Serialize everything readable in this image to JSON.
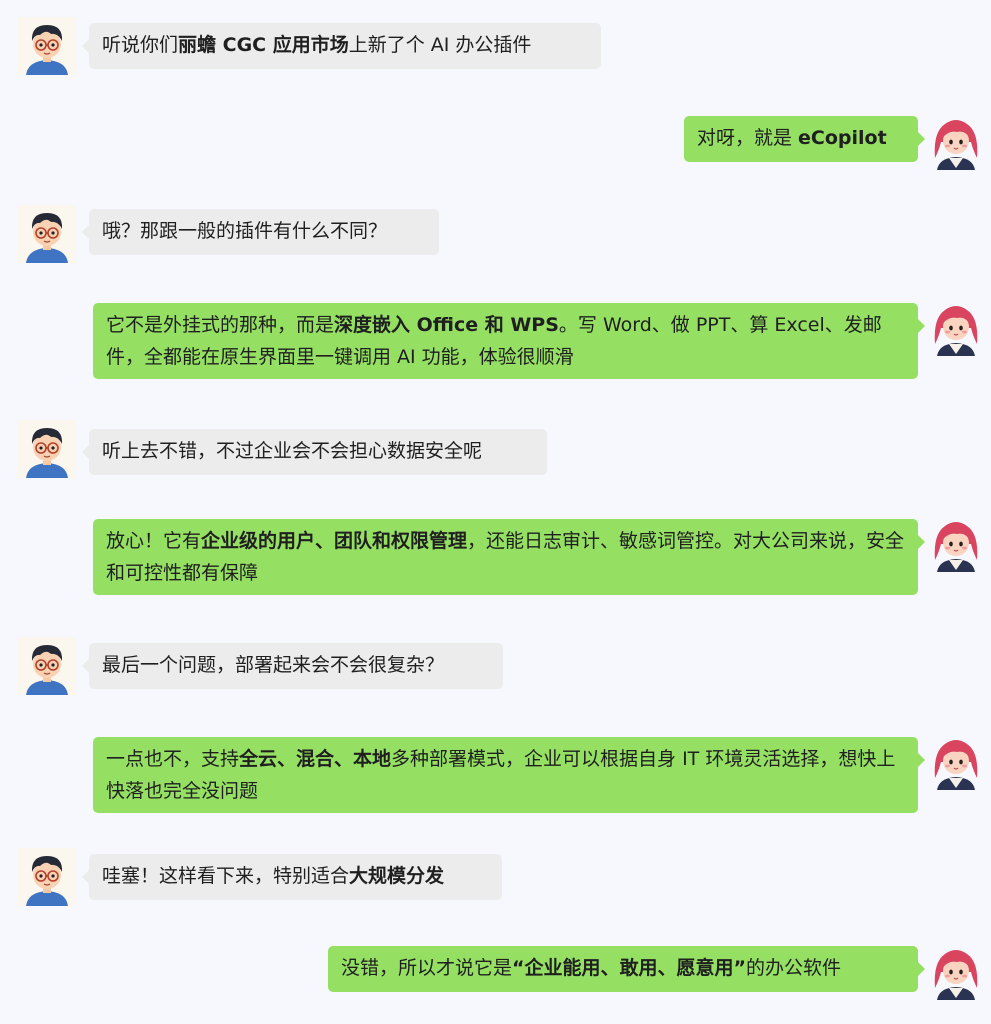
{
  "conversation": {
    "messages": [
      {
        "side": "left",
        "segments": [
          {
            "t": "听说你们"
          },
          {
            "t": "丽蟾 CGC 应用市场",
            "b": true
          },
          {
            "t": "上新了个 AI 办公插件"
          }
        ]
      },
      {
        "side": "right",
        "segments": [
          {
            "t": "对呀，就是 "
          },
          {
            "t": "eCopilot",
            "b": true
          }
        ]
      },
      {
        "side": "left",
        "segments": [
          {
            "t": "哦？那跟一般的插件有什么不同？"
          }
        ]
      },
      {
        "side": "right",
        "segments": [
          {
            "t": "它不是外挂式的那种，而是"
          },
          {
            "t": "深度嵌入 Office 和 WPS",
            "b": true
          },
          {
            "t": "。写 Word、做 PPT、算 Excel、发邮件，全都能在原生界面里一键调用 AI 功能，体验很顺滑"
          }
        ]
      },
      {
        "side": "left",
        "segments": [
          {
            "t": "听上去不错，不过企业会不会担心数据安全呢"
          }
        ]
      },
      {
        "side": "right",
        "segments": [
          {
            "t": "放心！它有"
          },
          {
            "t": "企业级的用户、团队和权限管理",
            "b": true
          },
          {
            "t": "，还能日志审计、敏感词管控。对大公司来说，安全和可控性都有保障"
          }
        ]
      },
      {
        "side": "left",
        "segments": [
          {
            "t": "最后一个问题，部署起来会不会很复杂？"
          }
        ]
      },
      {
        "side": "right",
        "segments": [
          {
            "t": "一点也不，支持"
          },
          {
            "t": "全云、混合、本地",
            "b": true
          },
          {
            "t": "多种部署模式，企业可以根据自身 IT 环境灵活选择，想快上快落也完全没问题"
          }
        ]
      },
      {
        "side": "left",
        "segments": [
          {
            "t": "哇塞！这样看下来，特别适合"
          },
          {
            "t": "大规模分发",
            "b": true
          }
        ]
      },
      {
        "side": "right",
        "segments": [
          {
            "t": "没错，所以才说它是"
          },
          {
            "t": "“企业能用、敢用、愿意用”",
            "b": true
          },
          {
            "t": "的办公软件"
          }
        ]
      }
    ]
  },
  "avatars": {
    "male": {
      "icon": "boy-with-glasses-avatar"
    },
    "female": {
      "icon": "girl-pink-hair-avatar"
    }
  },
  "colors": {
    "background": "#f6f8fd",
    "left_bubble": "#ececec",
    "right_bubble": "#95e063"
  }
}
